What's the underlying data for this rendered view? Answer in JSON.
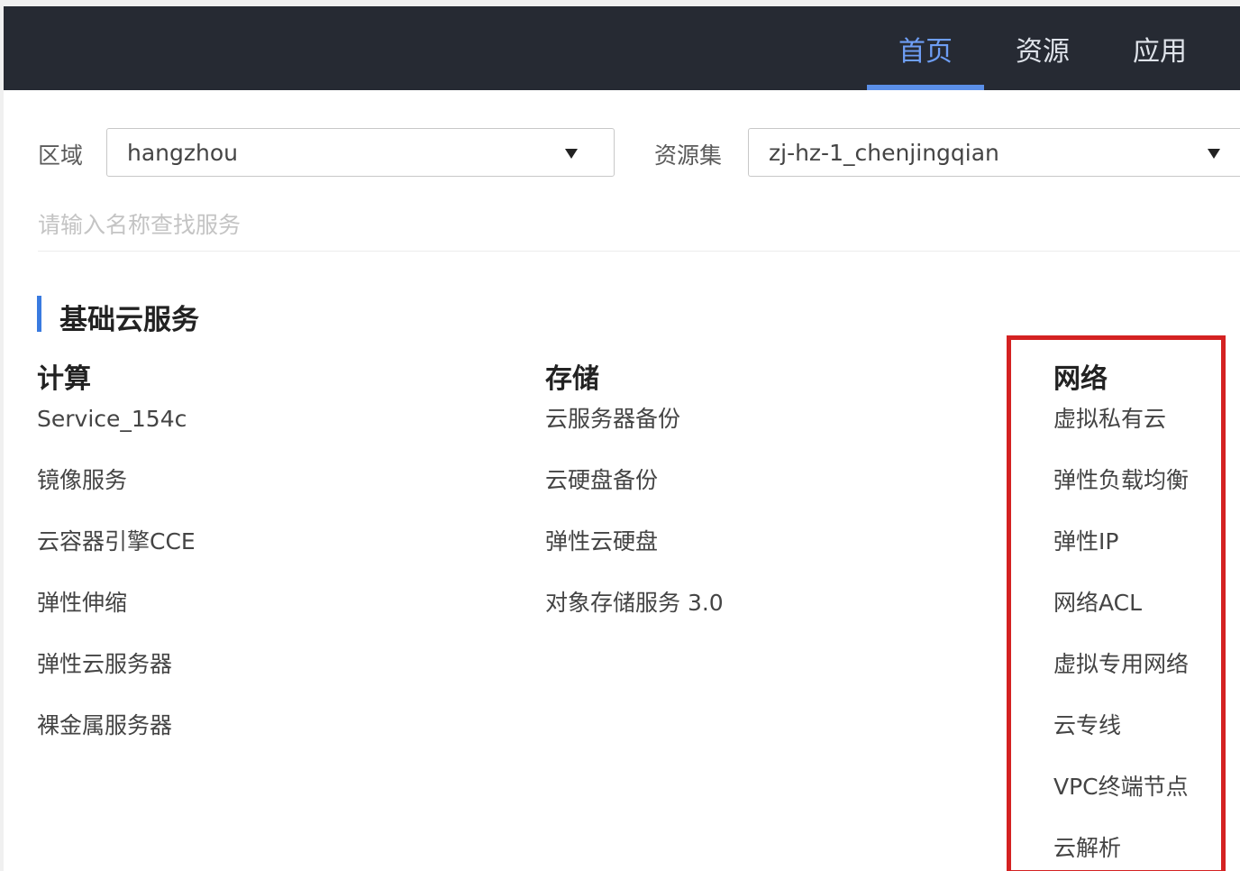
{
  "nav": {
    "items": [
      {
        "label": "首页",
        "active": true
      },
      {
        "label": "资源",
        "active": false
      },
      {
        "label": "应用",
        "active": false
      }
    ]
  },
  "filters": {
    "region_label": "区域",
    "region_value": "hangzhou",
    "resource_set_label": "资源集",
    "resource_set_value": "zj-hz-1_chenjingqian",
    "search_placeholder": "请输入名称查找服务"
  },
  "section": {
    "title": "基础云服务",
    "columns": [
      {
        "title": "计算",
        "items": [
          "Service_154c",
          "镜像服务",
          "云容器引擎CCE",
          "弹性伸缩",
          "弹性云服务器",
          "裸金属服务器"
        ]
      },
      {
        "title": "存储",
        "items": [
          "云服务器备份",
          "云硬盘备份",
          "弹性云硬盘",
          "对象存储服务 3.0"
        ]
      },
      {
        "title": "网络",
        "items": [
          "虚拟私有云",
          "弹性负载均衡",
          "弹性IP",
          "网络ACL",
          "虚拟专用网络",
          "云专线",
          "VPC终端节点",
          "云解析"
        ]
      }
    ]
  },
  "colors": {
    "topbar": "#262a33",
    "accent": "#5b8fe8",
    "highlight": "#d42222"
  },
  "icons": {
    "dropdown": "caret-down-icon"
  }
}
